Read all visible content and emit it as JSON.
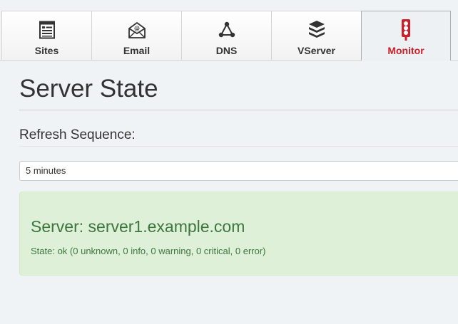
{
  "nav": {
    "tabs": [
      {
        "label": "Sites",
        "icon": "sites-icon"
      },
      {
        "label": "Email",
        "icon": "email-icon"
      },
      {
        "label": "DNS",
        "icon": "dns-icon"
      },
      {
        "label": "VServer",
        "icon": "vserver-icon"
      },
      {
        "label": "Monitor",
        "icon": "monitor-icon",
        "active": true
      }
    ]
  },
  "page": {
    "title": "Server State"
  },
  "refresh": {
    "label": "Refresh Sequence:",
    "selected": "5 minutes"
  },
  "status": {
    "server": "Server: server1.example.com",
    "state": "State: ok (0 unknown, 0 info, 0 warning, 0 critical, 0 error)"
  },
  "colors": {
    "accent": "#c9202a",
    "success_text": "#3c763d",
    "success_bg": "#dff0d8"
  }
}
